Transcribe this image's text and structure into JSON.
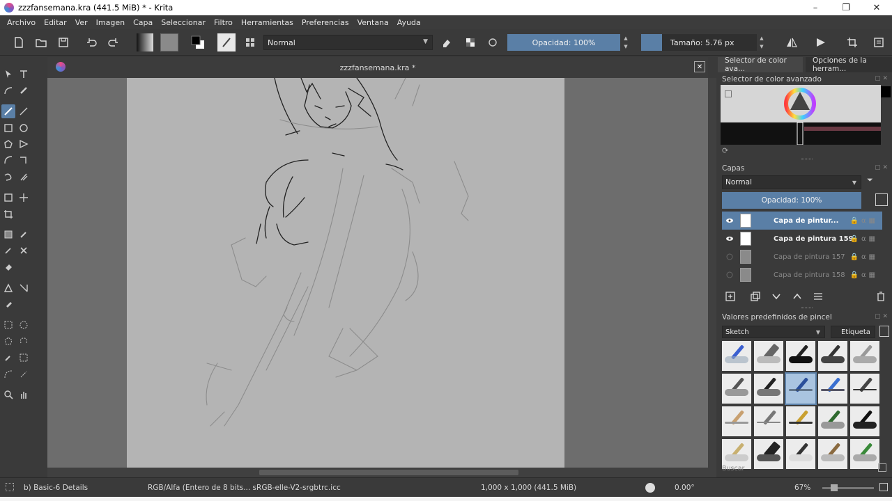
{
  "window": {
    "title": "zzzfansemana.kra (441.5 MiB)  * - Krita",
    "minimize": "–",
    "maximize": "❐",
    "close": "✕"
  },
  "menu": [
    "Archivo",
    "Editar",
    "Ver",
    "Imagen",
    "Capa",
    "Seleccionar",
    "Filtro",
    "Herramientas",
    "Preferencias",
    "Ventana",
    "Ayuda"
  ],
  "toolbar": {
    "blend_mode": "Normal",
    "opacity": "Opacidad: 100%",
    "size": "Tamaño: 5.76 px",
    "colors": {
      "accent": "#5a7fa6",
      "background": "#3a3a3a"
    }
  },
  "document": {
    "tab_title": "zzzfansemana.kra *",
    "close": "✕"
  },
  "dockers": {
    "tabs": [
      "Selector de color ava...",
      "Opciones de la herram..."
    ],
    "color_selector_title": "Selector de color avanzado",
    "layers_title": "Capas",
    "layer_blend": "Normal",
    "layer_opacity": "Opacidad:  100%",
    "layers": [
      {
        "name": "Capa de pintur...",
        "visible": true,
        "selected": true
      },
      {
        "name": "Capa de pintura 159",
        "visible": true,
        "selected": false
      },
      {
        "name": "Capa de pintura 157",
        "visible": false,
        "selected": false
      },
      {
        "name": "Capa de pintura 158",
        "visible": false,
        "selected": false
      }
    ],
    "presets_title": "Valores predefinidos de pincel",
    "preset_group": "Sketch",
    "tag_label": "Etiqueta",
    "search": "Buscar"
  },
  "status": {
    "brush": "b) Basic-6 Details",
    "colorspace": "RGB/Alfa (Entero de 8 bits...  sRGB-elle-V2-srgbtrc.icc",
    "dimensions": "1,000 x 1,000 (441.5 MiB)",
    "rotation": "0.00°",
    "zoom": "67%"
  }
}
